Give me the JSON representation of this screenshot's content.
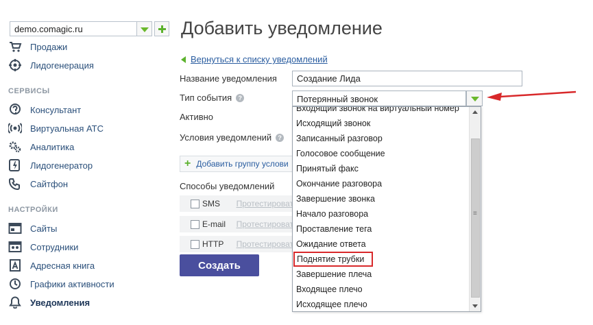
{
  "sidebar": {
    "site_select": {
      "value": "demo.comagic.ru"
    },
    "items_top": [
      {
        "label": "Продажи",
        "icon": "cart-icon"
      },
      {
        "label": "Лидогенерация",
        "icon": "target-icon"
      }
    ],
    "section_services": "СЕРВИСЫ",
    "items_services": [
      {
        "label": "Консультант",
        "icon": "chat-question-icon"
      },
      {
        "label": "Виртуальная АТС",
        "icon": "radio-waves-icon"
      },
      {
        "label": "Аналитика",
        "icon": "gears-icon"
      },
      {
        "label": "Лидогенератор",
        "icon": "lightning-icon"
      },
      {
        "label": "Сайтфон",
        "icon": "phone-icon"
      }
    ],
    "section_settings": "НАСТРОЙКИ",
    "items_settings": [
      {
        "label": "Сайты",
        "icon": "window-icon"
      },
      {
        "label": "Сотрудники",
        "icon": "people-icon"
      },
      {
        "label": "Адресная книга",
        "icon": "address-book-icon"
      },
      {
        "label": "Графики активности",
        "icon": "clock-icon"
      },
      {
        "label": "Уведомления",
        "icon": "bell-icon",
        "active": true
      }
    ]
  },
  "main": {
    "title": "Добавить уведомление",
    "back_link": "Вернуться к списку уведомлений",
    "fields": {
      "name_label": "Название уведомления",
      "name_value": "Создание Лида",
      "event_type_label": "Тип события",
      "event_type_value": "Потерянный звонок",
      "active_label": "Активно",
      "conditions_label": "Условия уведомлений"
    },
    "add_group_button": "Добавить группу услови",
    "methods_label": "Способы уведомлений",
    "methods": [
      {
        "label": "SMS",
        "test": "Протестироват"
      },
      {
        "label": "E-mail",
        "test": "Протестироват"
      },
      {
        "label": "HTTP",
        "test": "Протестироват"
      }
    ],
    "create_button": "Создать"
  },
  "dropdown": {
    "options": [
      "Входящий звонок на виртуальный номер",
      "Исходящий звонок",
      "Записанный разговор",
      "Голосовое сообщение",
      "Принятый факс",
      "Окончание разговора",
      "Завершение звонка",
      "Начало разговора",
      "Проставление тега",
      "Ожидание ответа",
      "Поднятие трубки",
      "Завершение плеча",
      "Входящее плечо",
      "Исходящее плечо"
    ],
    "highlighted": "Поднятие трубки"
  },
  "colors": {
    "accent_green": "#5cb22d",
    "link_blue": "#2a5da0",
    "button_purple": "#4a4f9e",
    "highlight_red": "#d8282a"
  }
}
